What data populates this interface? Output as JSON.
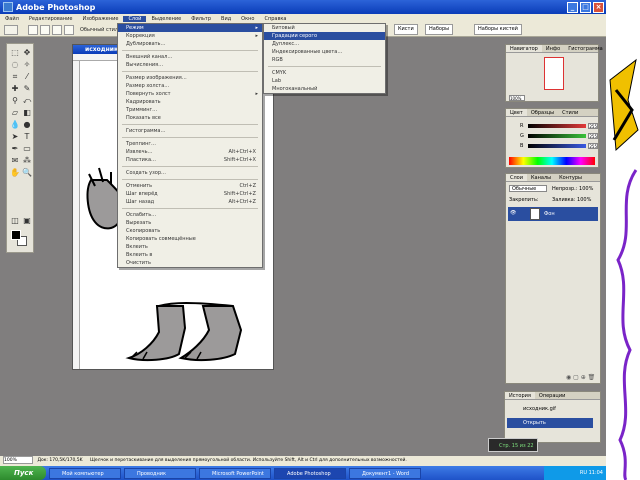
{
  "window": {
    "title": "Adobe Photoshop",
    "minimize": "_",
    "maximize": "□",
    "close": "×"
  },
  "menubar": [
    "Файл",
    "Редактирование",
    "Изображение",
    "Слой",
    "Выделение",
    "Фильтр",
    "Вид",
    "Окно",
    "Справка"
  ],
  "options": {
    "style_label": "Обычный стиль",
    "well_label": "Кисти",
    "tab1": "Кисти",
    "tab2": "Наборы",
    "tab3": "Наборы кистей"
  },
  "document": {
    "title": "исходник.gif"
  },
  "menu_image": {
    "items": [
      {
        "label": "Режим",
        "sc": "",
        "sub": true,
        "hl": true
      },
      {
        "label": "Коррекция",
        "sc": "",
        "sub": true
      },
      {
        "label": "Дублировать…",
        "sc": ""
      },
      {
        "sep": true
      },
      {
        "label": "Внешний канал…",
        "sc": ""
      },
      {
        "label": "Вычисления…",
        "sc": ""
      },
      {
        "sep": true
      },
      {
        "label": "Размер изображения…",
        "sc": ""
      },
      {
        "label": "Размер холста…",
        "sc": ""
      },
      {
        "label": "Повернуть холст",
        "sc": "",
        "sub": true
      },
      {
        "label": "Кадрировать",
        "sc": ""
      },
      {
        "label": "Тримминг…",
        "sc": ""
      },
      {
        "label": "Показать все",
        "sc": ""
      },
      {
        "sep": true
      },
      {
        "label": "Гистограмма…",
        "sc": ""
      },
      {
        "sep": true
      },
      {
        "label": "Треппинг…",
        "sc": ""
      },
      {
        "label": "Извлечь…",
        "sc": "Alt+Ctrl+X"
      },
      {
        "label": "Пластика…",
        "sc": "Shift+Ctrl+X"
      },
      {
        "sep": true
      },
      {
        "label": "Создать узор…",
        "sc": ""
      },
      {
        "sep": true
      },
      {
        "label": "Отменить",
        "sc": "Ctrl+Z"
      },
      {
        "label": "Шаг вперёд",
        "sc": "Shift+Ctrl+Z"
      },
      {
        "label": "Шаг назад",
        "sc": "Alt+Ctrl+Z"
      },
      {
        "sep": true
      },
      {
        "label": "Ослабить…",
        "sc": ""
      },
      {
        "label": "Вырезать",
        "sc": ""
      },
      {
        "label": "Скопировать",
        "sc": ""
      },
      {
        "label": "Копировать совмещённые",
        "sc": ""
      },
      {
        "label": "Вклеить",
        "sc": ""
      },
      {
        "label": "Вклеить в",
        "sc": ""
      },
      {
        "label": "Очистить",
        "sc": ""
      }
    ]
  },
  "menu_mode": {
    "items": [
      {
        "label": "Битовый",
        "sc": ""
      },
      {
        "label": "Градации серого",
        "sc": "",
        "hl": true
      },
      {
        "label": "Дуплекс…",
        "sc": ""
      },
      {
        "label": "Индексированные цвета…",
        "sc": ""
      },
      {
        "label": "RGB",
        "sc": ""
      },
      {
        "sep": true
      },
      {
        "label": "CMYK",
        "sc": ""
      },
      {
        "label": "Lab",
        "sc": ""
      },
      {
        "label": "Многоканальный",
        "sc": ""
      }
    ]
  },
  "navigator": {
    "tabs": [
      "Навигатор",
      "Инфо",
      "Гистограмма"
    ],
    "zoom": "100%"
  },
  "color_palette": {
    "tabs": [
      "Цвет",
      "Образцы",
      "Стили"
    ],
    "channels": [
      {
        "label": "R",
        "value": "255",
        "color": "#e23a3a"
      },
      {
        "label": "G",
        "value": "255",
        "color": "#3ac23a"
      },
      {
        "label": "B",
        "value": "255",
        "color": "#3a5ae2"
      }
    ]
  },
  "layers": {
    "tabs": [
      "Слои",
      "Каналы",
      "Контуры"
    ],
    "blend": "Обычные",
    "opacity_label": "Непрозр.: 100%",
    "lock_label": "Закрепить:",
    "fill_label": "Заливка: 100%",
    "rows": [
      {
        "name": "Фон",
        "selected": true
      }
    ]
  },
  "history": {
    "tabs": [
      "История",
      "Операции"
    ],
    "rows": [
      {
        "label": "исходник.gif",
        "selected": false
      },
      {
        "label": "Открыть",
        "selected": true
      }
    ]
  },
  "statusbar": {
    "zoom": "100%",
    "doc": "Док: 170,5K/170,5K",
    "hint": "Щелчок и перетаскивание для выделения прямоугольной области. Используйте Shift, Alt и Ctrl для дополнительных возможностей."
  },
  "taskbar": {
    "start": "Пуск",
    "tasks": [
      {
        "label": "Мой компьютер",
        "active": false
      },
      {
        "label": "Проводник",
        "active": false
      },
      {
        "label": "Microsoft PowerPoint",
        "active": false
      },
      {
        "label": "Adobe Photoshop",
        "active": true
      },
      {
        "label": "Документ1 - Word",
        "active": false
      }
    ],
    "clock": "RU 11:04"
  },
  "hint_box": "Стр. 15 из 22",
  "colors": {
    "titlebar": "#0a3cb8",
    "workspace": "#807e7e",
    "highlight": "#2a4ea0",
    "start": "#2d8a2d"
  }
}
